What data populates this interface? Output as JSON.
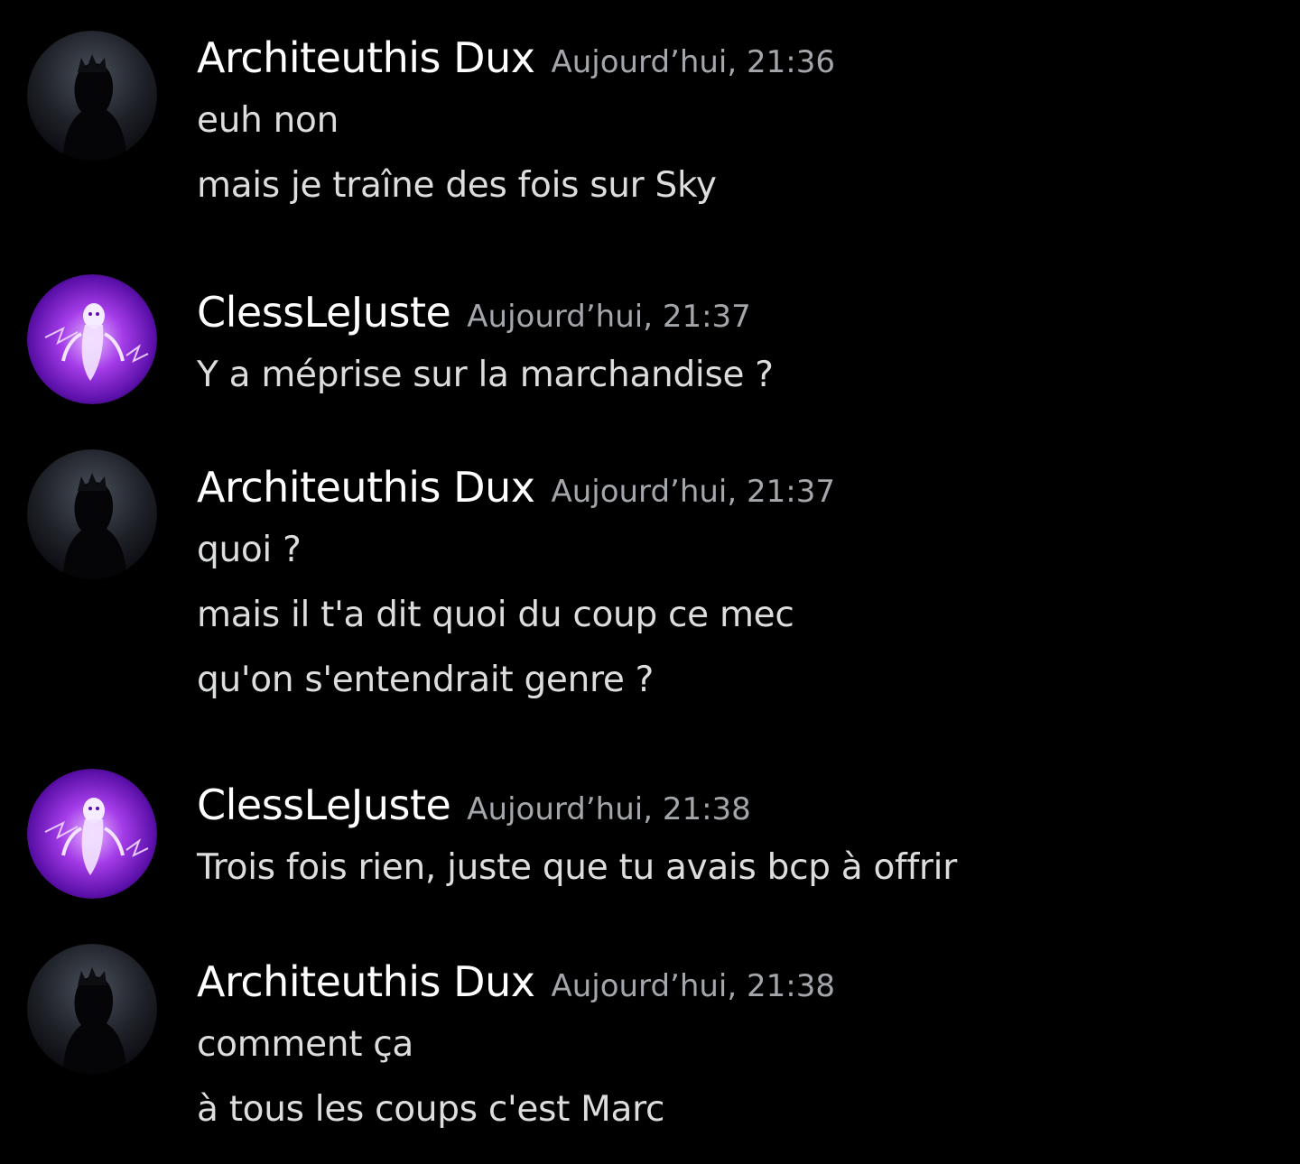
{
  "messages": [
    {
      "author": "Architeuthis Dux",
      "avatar": "dark-silhouette-avatar",
      "timestamp": "Aujourd’hui, 21:36",
      "lines": [
        "euh non",
        "mais je traîne des fois sur Sky"
      ]
    },
    {
      "author": "ClessLeJuste",
      "avatar": "purple-spirit-avatar",
      "timestamp": "Aujourd’hui, 21:37",
      "lines": [
        "Y a méprise sur la marchandise ?"
      ]
    },
    {
      "author": "Architeuthis Dux",
      "avatar": "dark-silhouette-avatar",
      "timestamp": "Aujourd’hui, 21:37",
      "lines": [
        "quoi ?",
        "mais il t'a dit quoi du coup ce mec",
        "qu'on s'entendrait genre ?"
      ]
    },
    {
      "author": "ClessLeJuste",
      "avatar": "purple-spirit-avatar",
      "timestamp": "Aujourd’hui, 21:38",
      "lines": [
        "Trois fois rien, juste que tu avais bcp à offrir"
      ]
    },
    {
      "author": "Architeuthis Dux",
      "avatar": "dark-silhouette-avatar",
      "timestamp": "Aujourd’hui, 21:38",
      "lines": [
        "comment ça",
        "à tous les coups c'est Marc"
      ]
    }
  ]
}
